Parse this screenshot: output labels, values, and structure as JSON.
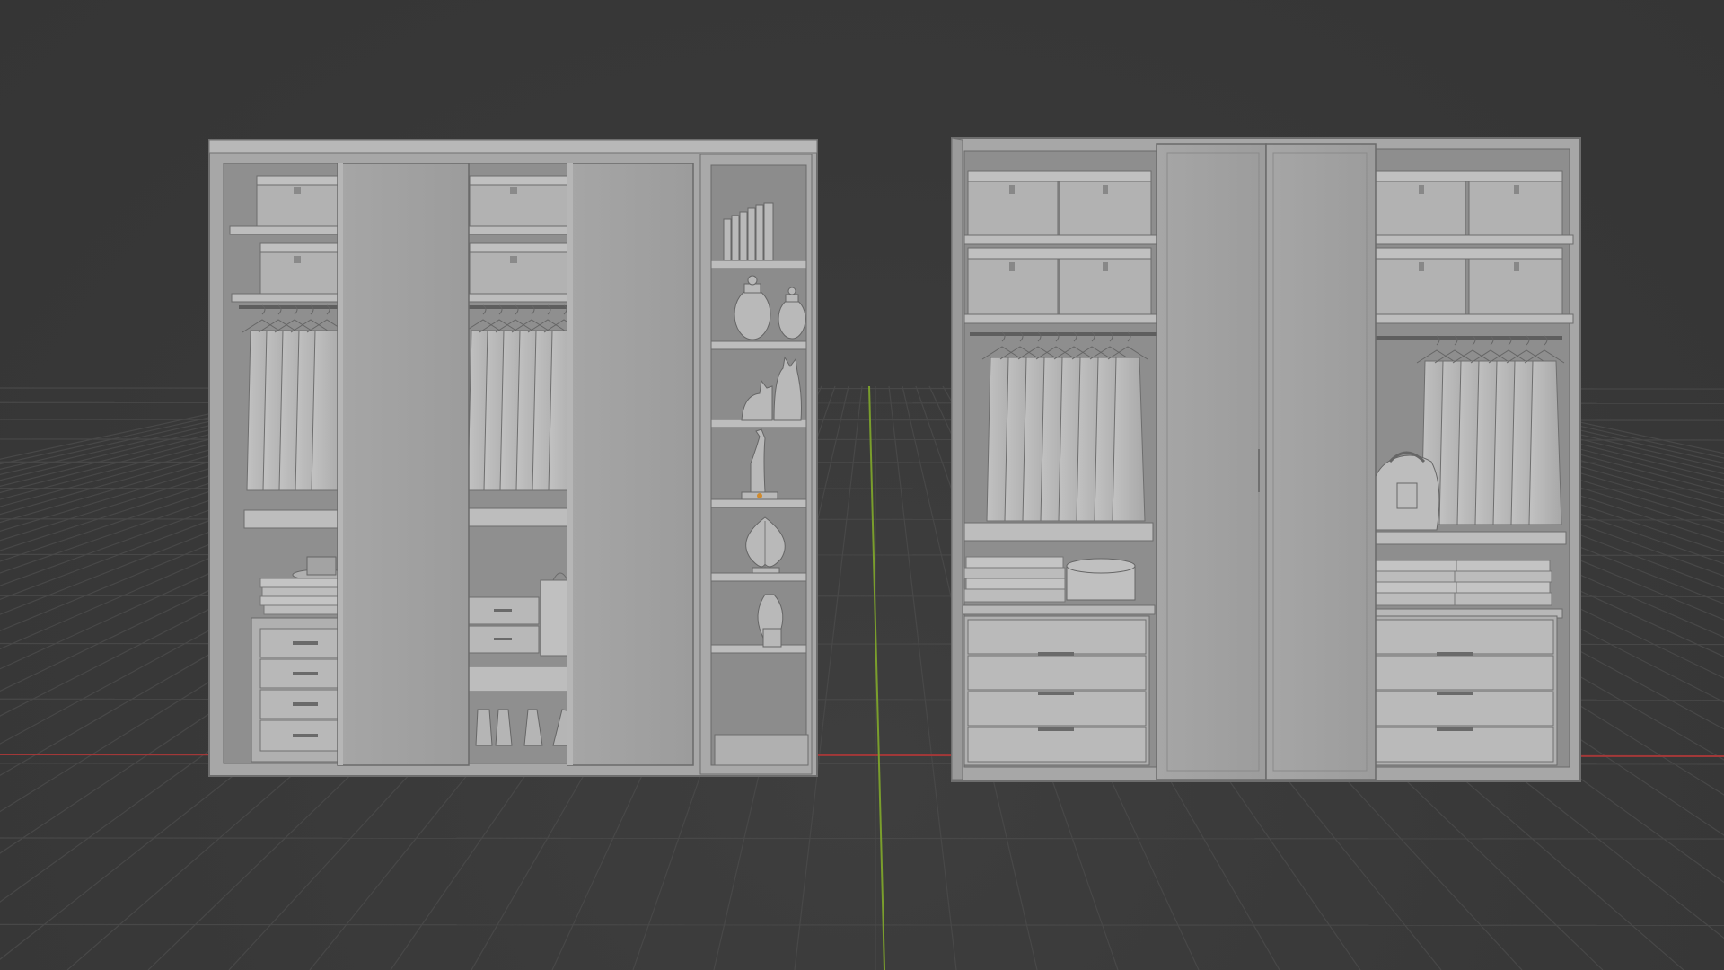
{
  "viewport": {
    "background": "#393939",
    "grid_color": "#4a4a4a",
    "x_axis_color": "#b33a3a",
    "y_axis_color": "#7fae2e",
    "view": "perspective"
  },
  "scene": {
    "objects": [
      {
        "name": "wardrobe-left",
        "shading": "solid",
        "color": "#a9a9a9"
      },
      {
        "name": "wardrobe-right",
        "shading": "solid",
        "color": "#a9a9a9"
      }
    ]
  }
}
